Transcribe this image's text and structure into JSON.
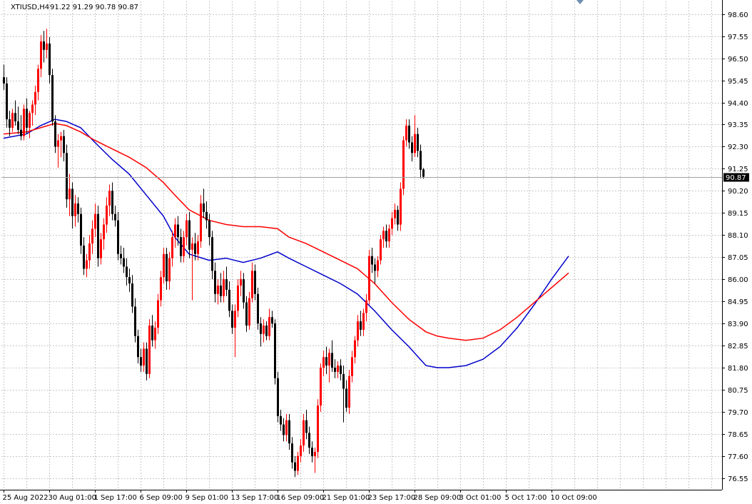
{
  "header": {
    "symbol": "XTIUSD,H4",
    "ohlc": "91.22 91.29 90.78 90.87"
  },
  "current_price_label": "90.87",
  "colors": {
    "background": "#ffffff",
    "grid": "#c8c8c8",
    "bull_candle": "#ff0000",
    "bear_candle": "#000000",
    "ma_fast": "#0000cc",
    "ma_slow": "#ff0000",
    "price_line": "#a0a0a0",
    "price_tag": "#000000"
  },
  "chart_data": {
    "type": "candlestick",
    "title": "",
    "xlabel": "",
    "ylabel": "",
    "ylim": [
      76.0,
      99.2
    ],
    "y_ticks": [
      76.55,
      77.6,
      78.65,
      79.7,
      80.75,
      81.8,
      82.85,
      83.9,
      84.95,
      86.0,
      87.05,
      88.1,
      89.15,
      90.2,
      91.25,
      92.3,
      93.35,
      94.4,
      95.45,
      96.5,
      97.55,
      98.6
    ],
    "x_tick_labels": [
      "25 Aug 2022",
      "30 Aug 01:00",
      "1 Sep 17:00",
      "6 Sep 09:00",
      "9 Sep 01:00",
      "13 Sep 17:00",
      "16 Sep 09:00",
      "21 Sep 01:00",
      "23 Sep 17:00",
      "28 Sep 09:00",
      "3 Oct 01:00",
      "5 Oct 17:00",
      "10 Oct 09:00"
    ],
    "x_tick_bar_index": [
      0,
      16,
      32,
      48,
      64,
      80,
      96,
      112,
      128,
      144,
      160,
      176,
      192
    ],
    "grid": true,
    "candles": [
      {
        "o": 95.6,
        "h": 96.2,
        "l": 95.0,
        "c": 95.3
      },
      {
        "o": 95.3,
        "h": 95.6,
        "l": 93.2,
        "c": 93.6
      },
      {
        "o": 93.6,
        "h": 94.0,
        "l": 92.8,
        "c": 93.2
      },
      {
        "o": 93.2,
        "h": 94.1,
        "l": 93.0,
        "c": 93.9
      },
      {
        "o": 93.9,
        "h": 94.5,
        "l": 93.3,
        "c": 93.5
      },
      {
        "o": 93.5,
        "h": 94.2,
        "l": 92.9,
        "c": 93.1
      },
      {
        "o": 93.1,
        "h": 93.8,
        "l": 92.6,
        "c": 92.8
      },
      {
        "o": 92.8,
        "h": 94.3,
        "l": 92.6,
        "c": 94.1
      },
      {
        "o": 94.1,
        "h": 94.6,
        "l": 92.9,
        "c": 93.2
      },
      {
        "o": 93.2,
        "h": 94.0,
        "l": 92.7,
        "c": 93.9
      },
      {
        "o": 93.9,
        "h": 94.5,
        "l": 93.3,
        "c": 94.3
      },
      {
        "o": 94.3,
        "h": 95.2,
        "l": 93.8,
        "c": 94.9
      },
      {
        "o": 94.9,
        "h": 96.2,
        "l": 94.5,
        "c": 96.0
      },
      {
        "o": 96.0,
        "h": 97.6,
        "l": 95.6,
        "c": 97.3
      },
      {
        "o": 97.3,
        "h": 97.8,
        "l": 96.3,
        "c": 96.9
      },
      {
        "o": 96.9,
        "h": 97.9,
        "l": 96.5,
        "c": 97.2
      },
      {
        "o": 97.2,
        "h": 97.5,
        "l": 95.3,
        "c": 95.7
      },
      {
        "o": 95.7,
        "h": 96.0,
        "l": 93.3,
        "c": 93.5
      },
      {
        "o": 93.5,
        "h": 93.8,
        "l": 92.0,
        "c": 92.3
      },
      {
        "o": 92.3,
        "h": 92.9,
        "l": 91.3,
        "c": 92.6
      },
      {
        "o": 92.6,
        "h": 93.0,
        "l": 91.8,
        "c": 92.8
      },
      {
        "o": 92.8,
        "h": 93.1,
        "l": 91.6,
        "c": 92.0
      },
      {
        "o": 92.0,
        "h": 92.4,
        "l": 89.4,
        "c": 89.8
      },
      {
        "o": 89.8,
        "h": 91.0,
        "l": 89.0,
        "c": 90.3
      },
      {
        "o": 90.3,
        "h": 90.6,
        "l": 88.4,
        "c": 89.0
      },
      {
        "o": 89.0,
        "h": 90.0,
        "l": 88.5,
        "c": 89.6
      },
      {
        "o": 89.6,
        "h": 89.9,
        "l": 88.7,
        "c": 89.1
      },
      {
        "o": 89.1,
        "h": 89.4,
        "l": 87.2,
        "c": 87.6
      },
      {
        "o": 87.6,
        "h": 88.0,
        "l": 86.2,
        "c": 86.5
      },
      {
        "o": 86.5,
        "h": 87.2,
        "l": 86.1,
        "c": 86.9
      },
      {
        "o": 86.9,
        "h": 88.1,
        "l": 86.5,
        "c": 87.7
      },
      {
        "o": 87.7,
        "h": 88.8,
        "l": 87.2,
        "c": 88.4
      },
      {
        "o": 88.4,
        "h": 89.6,
        "l": 88.0,
        "c": 89.1
      },
      {
        "o": 89.1,
        "h": 89.5,
        "l": 86.6,
        "c": 87.0
      },
      {
        "o": 87.0,
        "h": 88.2,
        "l": 86.7,
        "c": 87.9
      },
      {
        "o": 87.9,
        "h": 88.9,
        "l": 87.4,
        "c": 88.6
      },
      {
        "o": 88.6,
        "h": 89.9,
        "l": 88.2,
        "c": 89.5
      },
      {
        "o": 89.5,
        "h": 90.5,
        "l": 89.0,
        "c": 90.2
      },
      {
        "o": 90.2,
        "h": 90.6,
        "l": 88.8,
        "c": 89.1
      },
      {
        "o": 89.1,
        "h": 89.5,
        "l": 88.5,
        "c": 88.8
      },
      {
        "o": 88.8,
        "h": 89.2,
        "l": 86.9,
        "c": 87.2
      },
      {
        "o": 87.2,
        "h": 87.6,
        "l": 86.7,
        "c": 87.0
      },
      {
        "o": 87.0,
        "h": 87.5,
        "l": 86.3,
        "c": 86.6
      },
      {
        "o": 86.6,
        "h": 87.0,
        "l": 85.7,
        "c": 86.1
      },
      {
        "o": 86.1,
        "h": 86.5,
        "l": 85.4,
        "c": 85.8
      },
      {
        "o": 85.8,
        "h": 86.2,
        "l": 84.4,
        "c": 84.7
      },
      {
        "o": 84.7,
        "h": 85.1,
        "l": 83.0,
        "c": 83.3
      },
      {
        "o": 83.3,
        "h": 83.6,
        "l": 82.0,
        "c": 82.3
      },
      {
        "o": 82.3,
        "h": 82.7,
        "l": 81.6,
        "c": 81.9
      },
      {
        "o": 81.9,
        "h": 83.0,
        "l": 81.6,
        "c": 82.7
      },
      {
        "o": 82.7,
        "h": 83.0,
        "l": 81.2,
        "c": 81.5
      },
      {
        "o": 81.5,
        "h": 84.1,
        "l": 81.3,
        "c": 83.8
      },
      {
        "o": 83.8,
        "h": 84.3,
        "l": 82.8,
        "c": 83.1
      },
      {
        "o": 83.1,
        "h": 84.0,
        "l": 82.7,
        "c": 83.7
      },
      {
        "o": 83.7,
        "h": 85.3,
        "l": 83.4,
        "c": 85.0
      },
      {
        "o": 85.0,
        "h": 86.4,
        "l": 84.7,
        "c": 86.1
      },
      {
        "o": 86.1,
        "h": 87.5,
        "l": 85.8,
        "c": 87.2
      },
      {
        "o": 87.2,
        "h": 87.5,
        "l": 85.5,
        "c": 85.9
      },
      {
        "o": 85.9,
        "h": 87.3,
        "l": 85.5,
        "c": 87.0
      },
      {
        "o": 87.0,
        "h": 88.3,
        "l": 86.6,
        "c": 88.0
      },
      {
        "o": 88.0,
        "h": 88.9,
        "l": 87.5,
        "c": 88.6
      },
      {
        "o": 88.6,
        "h": 89.0,
        "l": 87.6,
        "c": 88.0
      },
      {
        "o": 88.0,
        "h": 88.4,
        "l": 86.8,
        "c": 87.1
      },
      {
        "o": 87.1,
        "h": 88.3,
        "l": 86.8,
        "c": 88.0
      },
      {
        "o": 88.0,
        "h": 89.1,
        "l": 87.6,
        "c": 88.8
      },
      {
        "o": 88.8,
        "h": 89.2,
        "l": 87.0,
        "c": 87.4
      },
      {
        "o": 87.4,
        "h": 88.0,
        "l": 85.0,
        "c": 87.7
      },
      {
        "o": 87.7,
        "h": 88.2,
        "l": 86.9,
        "c": 87.2
      },
      {
        "o": 87.2,
        "h": 88.1,
        "l": 86.9,
        "c": 87.8
      },
      {
        "o": 87.8,
        "h": 90.0,
        "l": 87.5,
        "c": 89.6
      },
      {
        "o": 89.6,
        "h": 90.3,
        "l": 88.9,
        "c": 89.2
      },
      {
        "o": 89.2,
        "h": 89.7,
        "l": 88.4,
        "c": 88.8
      },
      {
        "o": 88.8,
        "h": 89.1,
        "l": 87.6,
        "c": 88.0
      },
      {
        "o": 88.0,
        "h": 88.3,
        "l": 86.0,
        "c": 86.4
      },
      {
        "o": 86.4,
        "h": 86.8,
        "l": 84.9,
        "c": 85.3
      },
      {
        "o": 85.3,
        "h": 86.0,
        "l": 84.8,
        "c": 85.7
      },
      {
        "o": 85.7,
        "h": 86.3,
        "l": 84.9,
        "c": 85.2
      },
      {
        "o": 85.2,
        "h": 86.4,
        "l": 84.9,
        "c": 86.0
      },
      {
        "o": 86.0,
        "h": 86.6,
        "l": 85.2,
        "c": 85.5
      },
      {
        "o": 85.5,
        "h": 85.9,
        "l": 84.2,
        "c": 84.5
      },
      {
        "o": 84.5,
        "h": 84.8,
        "l": 83.4,
        "c": 83.7
      },
      {
        "o": 83.7,
        "h": 84.8,
        "l": 82.3,
        "c": 84.5
      },
      {
        "o": 84.5,
        "h": 86.0,
        "l": 84.2,
        "c": 85.7
      },
      {
        "o": 85.7,
        "h": 86.4,
        "l": 85.2,
        "c": 86.0
      },
      {
        "o": 86.0,
        "h": 86.3,
        "l": 84.6,
        "c": 84.9
      },
      {
        "o": 84.9,
        "h": 85.2,
        "l": 83.5,
        "c": 83.8
      },
      {
        "o": 83.8,
        "h": 85.4,
        "l": 83.6,
        "c": 85.1
      },
      {
        "o": 85.1,
        "h": 86.8,
        "l": 84.9,
        "c": 86.4
      },
      {
        "o": 86.4,
        "h": 86.7,
        "l": 85.0,
        "c": 85.3
      },
      {
        "o": 85.3,
        "h": 85.6,
        "l": 83.6,
        "c": 83.9
      },
      {
        "o": 83.9,
        "h": 84.2,
        "l": 82.8,
        "c": 83.4
      },
      {
        "o": 83.4,
        "h": 84.1,
        "l": 83.0,
        "c": 83.8
      },
      {
        "o": 83.8,
        "h": 84.0,
        "l": 83.1,
        "c": 83.3
      },
      {
        "o": 83.3,
        "h": 84.6,
        "l": 83.1,
        "c": 84.2
      },
      {
        "o": 84.2,
        "h": 84.5,
        "l": 83.7,
        "c": 83.9
      },
      {
        "o": 83.9,
        "h": 84.1,
        "l": 81.0,
        "c": 81.3
      },
      {
        "o": 81.3,
        "h": 81.6,
        "l": 79.2,
        "c": 79.5
      },
      {
        "o": 79.5,
        "h": 79.8,
        "l": 78.8,
        "c": 79.1
      },
      {
        "o": 79.1,
        "h": 79.4,
        "l": 78.3,
        "c": 78.6
      },
      {
        "o": 78.6,
        "h": 79.6,
        "l": 78.3,
        "c": 79.3
      },
      {
        "o": 79.3,
        "h": 79.6,
        "l": 77.9,
        "c": 78.2
      },
      {
        "o": 78.2,
        "h": 78.5,
        "l": 77.0,
        "c": 77.3
      },
      {
        "o": 77.3,
        "h": 77.6,
        "l": 76.6,
        "c": 76.9
      },
      {
        "o": 76.9,
        "h": 77.8,
        "l": 76.7,
        "c": 77.6
      },
      {
        "o": 77.6,
        "h": 78.4,
        "l": 77.3,
        "c": 78.1
      },
      {
        "o": 78.1,
        "h": 79.6,
        "l": 77.8,
        "c": 79.3
      },
      {
        "o": 79.3,
        "h": 79.8,
        "l": 78.4,
        "c": 78.7
      },
      {
        "o": 78.7,
        "h": 79.0,
        "l": 77.7,
        "c": 78.0
      },
      {
        "o": 78.0,
        "h": 78.3,
        "l": 77.3,
        "c": 77.6
      },
      {
        "o": 77.6,
        "h": 78.0,
        "l": 76.8,
        "c": 77.8
      },
      {
        "o": 77.8,
        "h": 80.3,
        "l": 77.5,
        "c": 80.0
      },
      {
        "o": 80.0,
        "h": 82.0,
        "l": 79.7,
        "c": 81.8
      },
      {
        "o": 81.8,
        "h": 82.6,
        "l": 81.4,
        "c": 82.3
      },
      {
        "o": 82.3,
        "h": 82.8,
        "l": 81.5,
        "c": 81.9
      },
      {
        "o": 81.9,
        "h": 82.7,
        "l": 81.1,
        "c": 82.5
      },
      {
        "o": 82.5,
        "h": 83.1,
        "l": 81.6,
        "c": 81.8
      },
      {
        "o": 81.8,
        "h": 82.2,
        "l": 81.3,
        "c": 81.6
      },
      {
        "o": 81.6,
        "h": 82.1,
        "l": 81.3,
        "c": 81.9
      },
      {
        "o": 81.9,
        "h": 82.2,
        "l": 81.2,
        "c": 81.5
      },
      {
        "o": 81.5,
        "h": 81.9,
        "l": 79.2,
        "c": 80.8
      },
      {
        "o": 80.8,
        "h": 81.2,
        "l": 79.7,
        "c": 79.9
      },
      {
        "o": 79.9,
        "h": 81.7,
        "l": 79.6,
        "c": 81.4
      },
      {
        "o": 81.4,
        "h": 82.6,
        "l": 81.1,
        "c": 82.3
      },
      {
        "o": 82.3,
        "h": 83.3,
        "l": 82.0,
        "c": 83.1
      },
      {
        "o": 83.1,
        "h": 84.3,
        "l": 82.8,
        "c": 84.0
      },
      {
        "o": 84.0,
        "h": 84.5,
        "l": 83.3,
        "c": 83.6
      },
      {
        "o": 83.6,
        "h": 84.6,
        "l": 83.3,
        "c": 84.4
      },
      {
        "o": 84.4,
        "h": 85.3,
        "l": 84.0,
        "c": 85.0
      },
      {
        "o": 85.0,
        "h": 87.4,
        "l": 84.8,
        "c": 87.1
      },
      {
        "o": 87.1,
        "h": 87.5,
        "l": 86.3,
        "c": 86.7
      },
      {
        "o": 86.7,
        "h": 87.0,
        "l": 85.8,
        "c": 86.4
      },
      {
        "o": 86.4,
        "h": 87.1,
        "l": 86.1,
        "c": 86.9
      },
      {
        "o": 86.9,
        "h": 88.1,
        "l": 86.7,
        "c": 87.9
      },
      {
        "o": 87.9,
        "h": 88.5,
        "l": 87.5,
        "c": 88.3
      },
      {
        "o": 88.3,
        "h": 88.6,
        "l": 87.5,
        "c": 87.8
      },
      {
        "o": 87.8,
        "h": 88.6,
        "l": 87.5,
        "c": 88.4
      },
      {
        "o": 88.4,
        "h": 89.2,
        "l": 88.1,
        "c": 88.9
      },
      {
        "o": 88.9,
        "h": 89.6,
        "l": 88.6,
        "c": 89.3
      },
      {
        "o": 89.3,
        "h": 89.5,
        "l": 88.3,
        "c": 88.6
      },
      {
        "o": 88.6,
        "h": 90.6,
        "l": 88.3,
        "c": 90.3
      },
      {
        "o": 90.3,
        "h": 92.8,
        "l": 90.0,
        "c": 92.6
      },
      {
        "o": 92.6,
        "h": 93.6,
        "l": 92.3,
        "c": 93.3
      },
      {
        "o": 93.3,
        "h": 93.6,
        "l": 92.2,
        "c": 92.5
      },
      {
        "o": 92.5,
        "h": 92.8,
        "l": 91.6,
        "c": 92.0
      },
      {
        "o": 92.0,
        "h": 93.8,
        "l": 91.8,
        "c": 92.9
      },
      {
        "o": 92.9,
        "h": 93.2,
        "l": 91.8,
        "c": 92.1
      },
      {
        "o": 92.1,
        "h": 92.4,
        "l": 90.8,
        "c": 91.2
      },
      {
        "o": 91.22,
        "h": 91.29,
        "l": 90.78,
        "c": 90.87
      }
    ],
    "series": [
      {
        "kind": "ma_fast",
        "points": [
          [
            0,
            92.7
          ],
          [
            8,
            92.9
          ],
          [
            13,
            93.3
          ],
          [
            18,
            93.6
          ],
          [
            22,
            93.5
          ],
          [
            27,
            93.2
          ],
          [
            32,
            92.5
          ],
          [
            38,
            91.7
          ],
          [
            44,
            91.0
          ],
          [
            50,
            90.0
          ],
          [
            56,
            89.0
          ],
          [
            60,
            88.0
          ],
          [
            65,
            87.2
          ],
          [
            72,
            86.9
          ],
          [
            78,
            87.0
          ],
          [
            84,
            86.8
          ],
          [
            90,
            87.0
          ],
          [
            96,
            87.3
          ],
          [
            100,
            87.0
          ],
          [
            106,
            86.6
          ],
          [
            112,
            86.2
          ],
          [
            118,
            85.8
          ],
          [
            124,
            85.3
          ],
          [
            130,
            84.5
          ],
          [
            136,
            83.6
          ],
          [
            142,
            82.8
          ],
          [
            148,
            81.9
          ],
          [
            152,
            81.8
          ],
          [
            156,
            81.8
          ],
          [
            162,
            81.9
          ],
          [
            168,
            82.2
          ],
          [
            174,
            82.8
          ],
          [
            180,
            83.7
          ],
          [
            186,
            84.8
          ],
          [
            192,
            86.0
          ],
          [
            198,
            87.1
          ]
        ]
      },
      {
        "kind": "ma_slow",
        "points": [
          [
            0,
            92.9
          ],
          [
            8,
            93.0
          ],
          [
            13,
            93.2
          ],
          [
            18,
            93.4
          ],
          [
            22,
            93.3
          ],
          [
            27,
            93.0
          ],
          [
            32,
            92.6
          ],
          [
            38,
            92.2
          ],
          [
            44,
            91.8
          ],
          [
            50,
            91.3
          ],
          [
            56,
            90.6
          ],
          [
            60,
            90.0
          ],
          [
            65,
            89.3
          ],
          [
            72,
            88.8
          ],
          [
            78,
            88.6
          ],
          [
            84,
            88.5
          ],
          [
            90,
            88.5
          ],
          [
            96,
            88.4
          ],
          [
            100,
            88.0
          ],
          [
            106,
            87.7
          ],
          [
            112,
            87.3
          ],
          [
            118,
            86.9
          ],
          [
            124,
            86.5
          ],
          [
            130,
            85.8
          ],
          [
            136,
            84.9
          ],
          [
            142,
            84.1
          ],
          [
            148,
            83.5
          ],
          [
            152,
            83.3
          ],
          [
            156,
            83.2
          ],
          [
            162,
            83.1
          ],
          [
            168,
            83.2
          ],
          [
            174,
            83.6
          ],
          [
            180,
            84.2
          ],
          [
            186,
            84.9
          ],
          [
            192,
            85.6
          ],
          [
            198,
            86.3
          ]
        ]
      }
    ]
  }
}
